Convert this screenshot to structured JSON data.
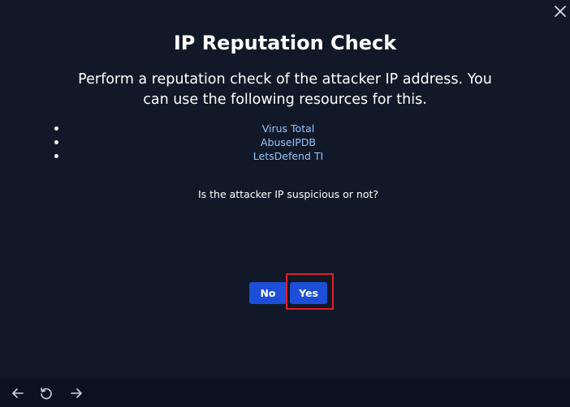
{
  "modal": {
    "title": "IP Reputation Check",
    "description": "Perform a reputation check of the attacker IP address. You can use the following resources for this.",
    "resources": [
      {
        "label": "Virus Total"
      },
      {
        "label": "AbuseIPDB"
      },
      {
        "label": "LetsDefend TI"
      }
    ],
    "question": "Is the attacker IP suspicious or not?",
    "buttons": {
      "no": "No",
      "yes": "Yes"
    },
    "close_icon": "close-icon"
  },
  "nav": {
    "icons": [
      "arrow-left-icon",
      "refresh-icon",
      "arrow-right-icon"
    ]
  },
  "colors": {
    "background": "#111827",
    "bottom_bar": "#0b1120",
    "button": "#1d4ed8",
    "link": "#93c5fd",
    "highlight": "#e11d2a"
  }
}
